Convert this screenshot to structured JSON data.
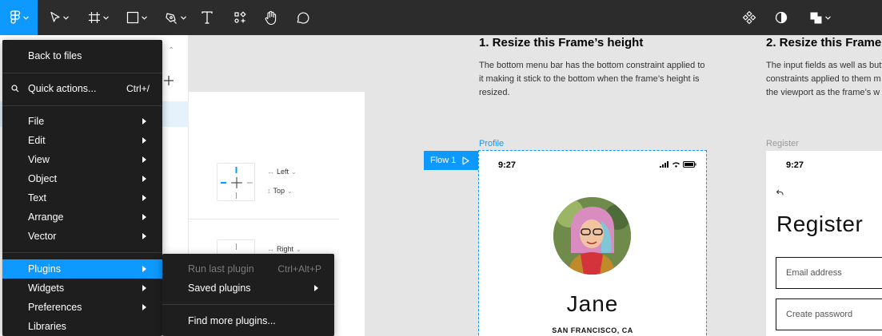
{
  "toolbar": {
    "tools": [
      {
        "name": "main-menu-button",
        "icon": "figma-logo-icon"
      },
      {
        "name": "move-tool",
        "icon": "cursor-icon"
      },
      {
        "name": "frame-tool",
        "icon": "frame-icon"
      },
      {
        "name": "shape-tool",
        "icon": "rectangle-icon"
      },
      {
        "name": "pen-tool",
        "icon": "pen-icon"
      },
      {
        "name": "text-tool",
        "icon": "text-icon"
      },
      {
        "name": "resources-tool",
        "icon": "resources-icon"
      },
      {
        "name": "hand-tool",
        "icon": "hand-icon"
      },
      {
        "name": "comment-tool",
        "icon": "comment-icon"
      },
      {
        "name": "component-button",
        "icon": "component-icon"
      },
      {
        "name": "mask-button",
        "icon": "contrast-icon"
      },
      {
        "name": "boolean-button",
        "icon": "boolean-icon"
      }
    ],
    "accent": "#0d99ff"
  },
  "menu": {
    "back_to_files": "Back to files",
    "quick_actions": "Quick actions...",
    "quick_actions_shortcut": "Ctrl+/",
    "items": {
      "file": "File",
      "edit": "Edit",
      "view": "View",
      "object": "Object",
      "text": "Text",
      "arrange": "Arrange",
      "vector": "Vector",
      "plugins": "Plugins",
      "widgets": "Widgets",
      "preferences": "Preferences",
      "libraries": "Libraries"
    }
  },
  "submenu": {
    "run_last_plugin": "Run last plugin",
    "run_last_plugin_shortcut": "Ctrl+Alt+P",
    "saved_plugins": "Saved plugins",
    "find_more_plugins": "Find more plugins..."
  },
  "constraints": {
    "horizontal_1": "Left",
    "vertical_1": "Top",
    "horizontal_2": "Right"
  },
  "canvas": {
    "section1_title": "1. Resize this Frame’s height",
    "section1_text": "The bottom menu bar has the bottom constraint applied to it making it stick to the bottom when the frame’s height is resized.",
    "section2_title": "2. Resize this Frame’s",
    "section2_text": "The input fields as well as butt constraints applied to them m the viewport as the frame’s w",
    "profile_label": "Profile",
    "register_label": "Register",
    "flow_label": "Flow 1"
  },
  "profile": {
    "time": "9:27",
    "name": "Jane",
    "city": "SAN FRANCISCO, CA"
  },
  "register": {
    "time": "9:27",
    "title": "Register",
    "email_placeholder": "Email address",
    "password_placeholder": "Create password"
  }
}
